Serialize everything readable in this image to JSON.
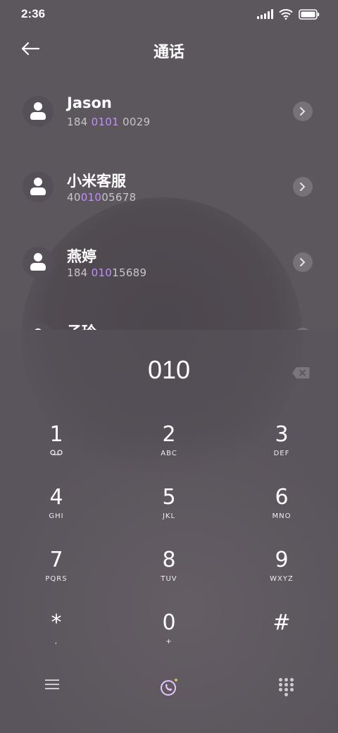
{
  "status": {
    "time": "2:36"
  },
  "header": {
    "title": "通话",
    "back_icon": "arrow-left-icon"
  },
  "contacts": [
    {
      "name": "Jason",
      "number_parts": [
        "184 ",
        "0101",
        " 0029"
      ]
    },
    {
      "name": "小米客服",
      "number_parts": [
        "40",
        "010",
        "05678"
      ]
    },
    {
      "name": "燕婷",
      "number_parts": [
        "184 ",
        "010",
        "15689"
      ]
    },
    {
      "name": "子玲",
      "number_parts": [
        "",
        "",
        ""
      ]
    }
  ],
  "dialer": {
    "input": "010",
    "keys": [
      {
        "digit": "1",
        "letters": ""
      },
      {
        "digit": "2",
        "letters": "ABC"
      },
      {
        "digit": "3",
        "letters": "DEF"
      },
      {
        "digit": "4",
        "letters": "GHI"
      },
      {
        "digit": "5",
        "letters": "JKL"
      },
      {
        "digit": "6",
        "letters": "MNO"
      },
      {
        "digit": "7",
        "letters": "PQRS"
      },
      {
        "digit": "8",
        "letters": "TUV"
      },
      {
        "digit": "9",
        "letters": "WXYZ"
      },
      {
        "digit": "*",
        "letters": ","
      },
      {
        "digit": "0",
        "letters": "+"
      },
      {
        "digit": "#",
        "letters": ""
      }
    ]
  },
  "colors": {
    "background": "#5c565d",
    "highlight": "#c38dff",
    "call_accent": "#e9c3ff"
  }
}
